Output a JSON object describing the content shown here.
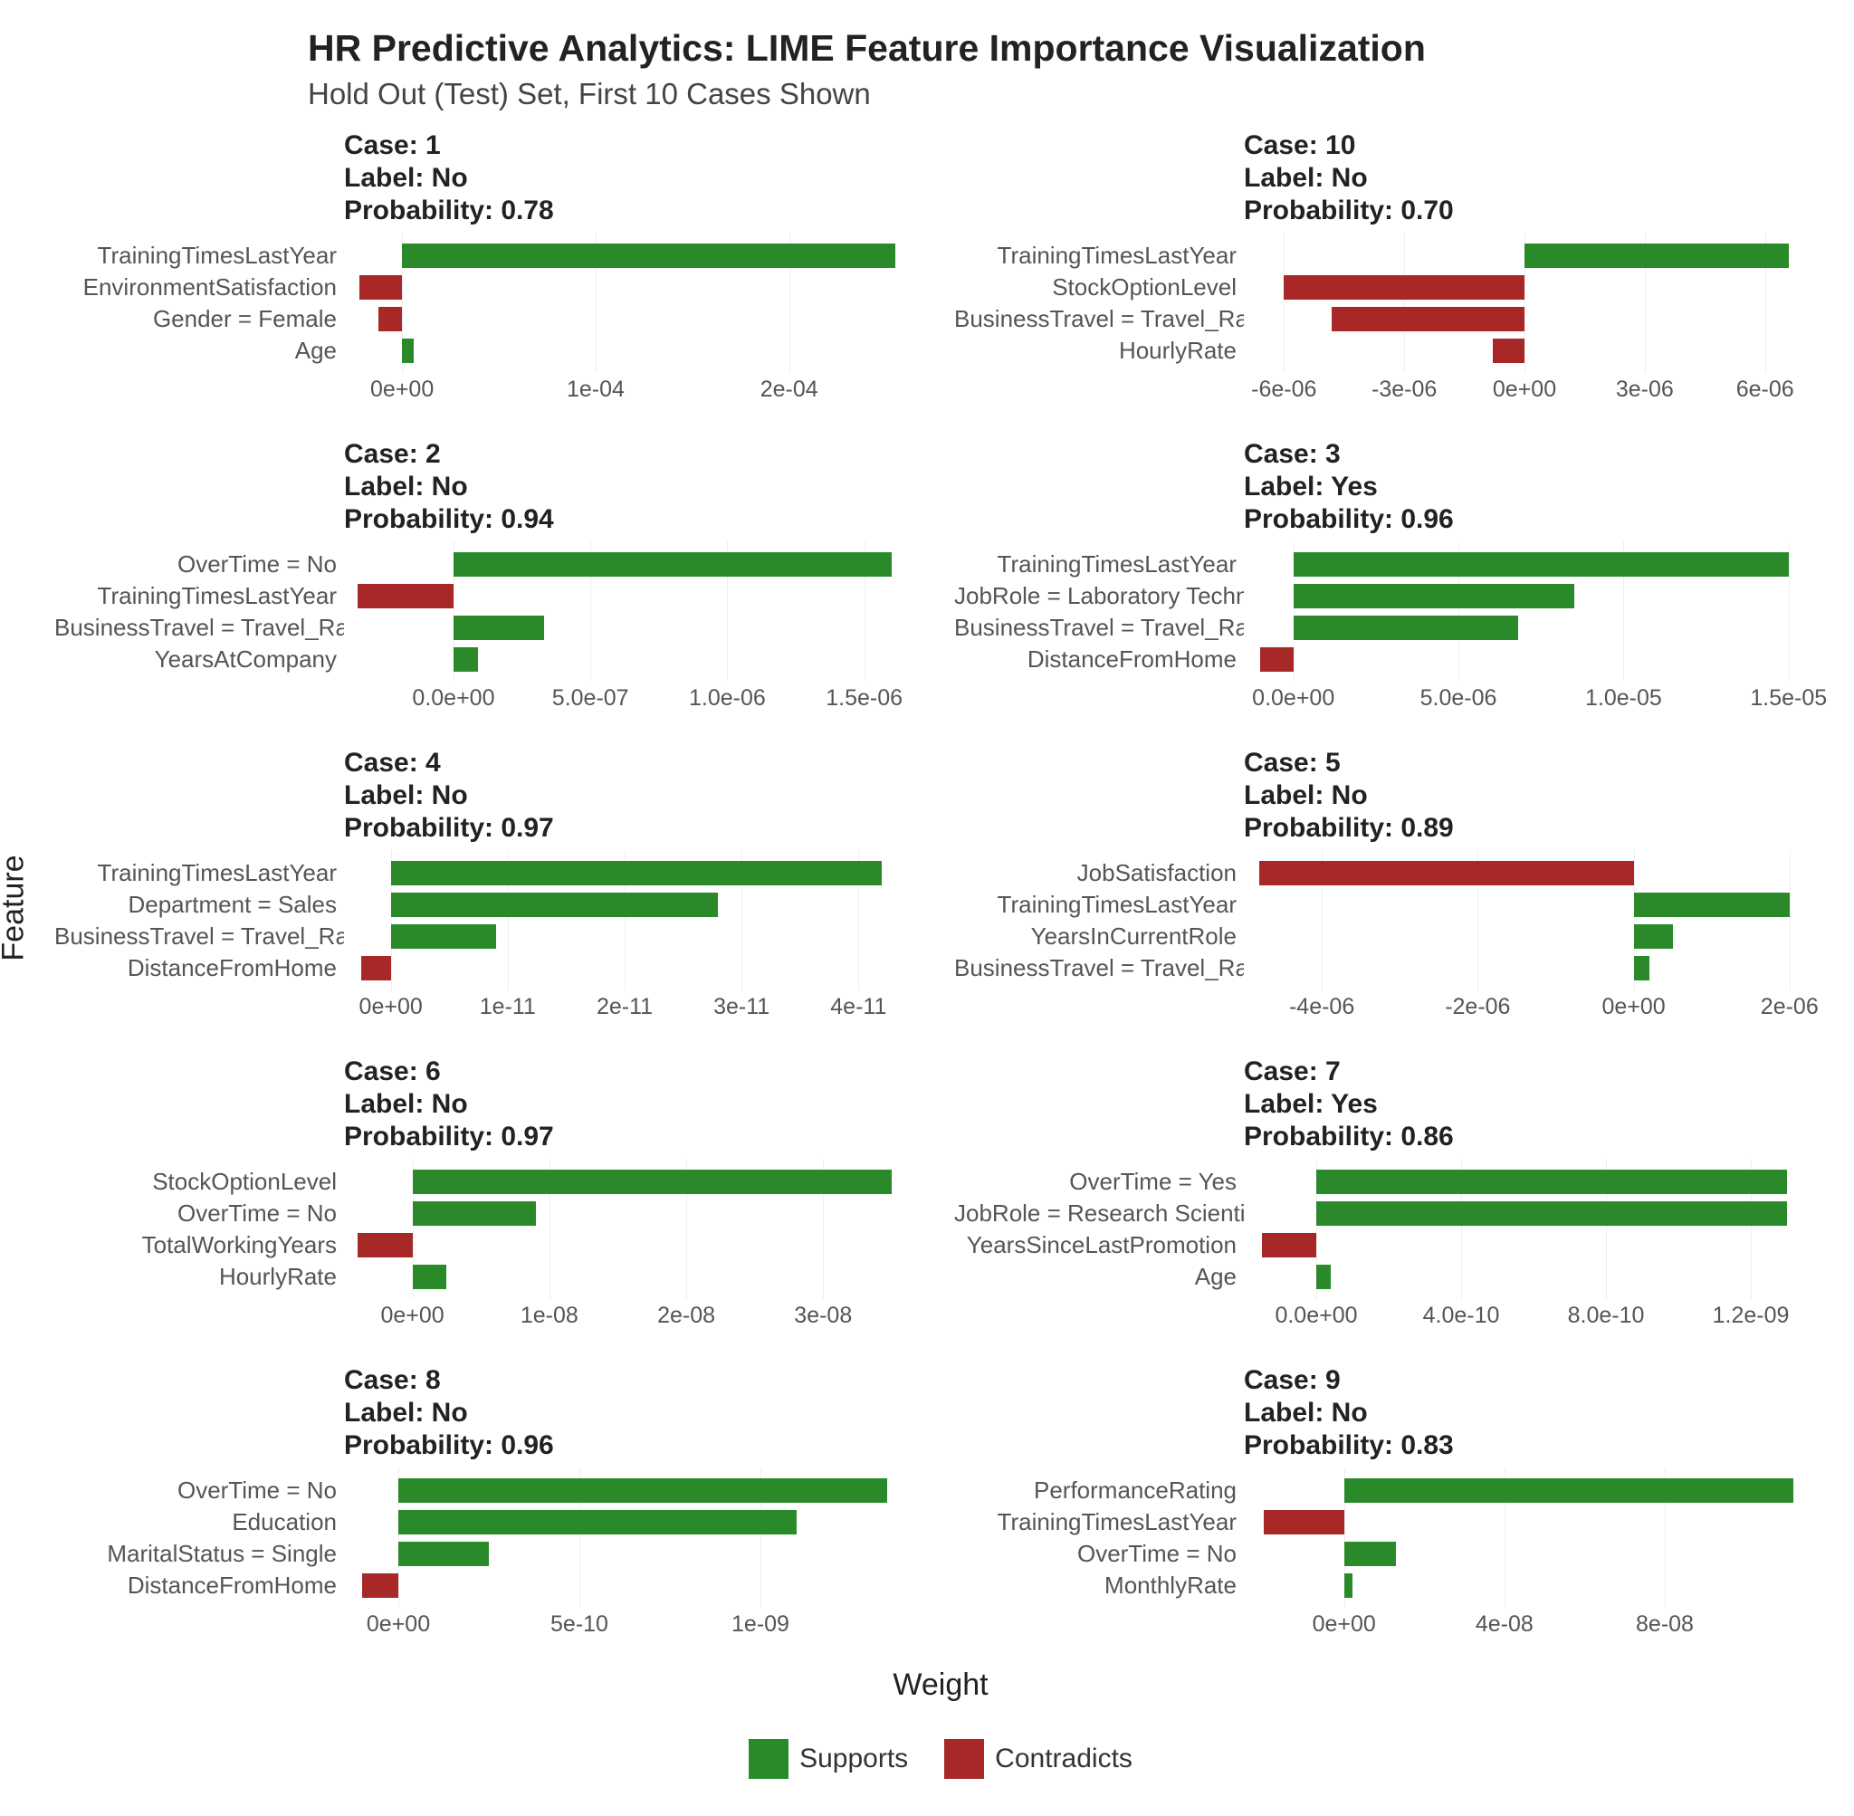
{
  "title": "HR Predictive Analytics: LIME Feature Importance Visualization",
  "subtitle": "Hold Out (Test) Set, First 10 Cases Shown",
  "ylabel": "Feature",
  "xlabel": "Weight",
  "legend": {
    "supports": "Supports",
    "contradicts": "Contradicts"
  },
  "colors": {
    "supports": "#2a8a2a",
    "contradicts": "#a82828"
  },
  "chart_data": [
    {
      "case": "Case: 1",
      "label": "Label: No",
      "prob": "Probability: 0.78",
      "xlim": [
        -3e-05,
        0.00026
      ],
      "ticks": [
        {
          "v": 0,
          "label": "0e+00"
        },
        {
          "v": 0.0001,
          "label": "1e-04"
        },
        {
          "v": 0.0002,
          "label": "2e-04"
        }
      ],
      "bars": [
        {
          "feature": "TrainingTimesLastYear",
          "value": 0.000255,
          "class": "supports"
        },
        {
          "feature": "EnvironmentSatisfaction",
          "value": -2.2e-05,
          "class": "contradicts"
        },
        {
          "feature": "Gender = Female",
          "value": -1.2e-05,
          "class": "contradicts"
        },
        {
          "feature": "Age",
          "value": 6e-06,
          "class": "supports"
        }
      ]
    },
    {
      "case": "Case: 10",
      "label": "Label: No",
      "prob": "Probability: 0.70",
      "xlim": [
        -7e-06,
        7e-06
      ],
      "ticks": [
        {
          "v": -6e-06,
          "label": "-6e-06"
        },
        {
          "v": -3e-06,
          "label": "-3e-06"
        },
        {
          "v": 0,
          "label": "0e+00"
        },
        {
          "v": 3e-06,
          "label": "3e-06"
        },
        {
          "v": 6e-06,
          "label": "6e-06"
        }
      ],
      "bars": [
        {
          "feature": "TrainingTimesLastYear",
          "value": 6.6e-06,
          "class": "supports"
        },
        {
          "feature": "StockOptionLevel",
          "value": -6e-06,
          "class": "contradicts"
        },
        {
          "feature": "BusinessTravel = Travel_Rarely",
          "value": -4.8e-06,
          "class": "contradicts"
        },
        {
          "feature": "HourlyRate",
          "value": -8e-07,
          "class": "contradicts"
        }
      ]
    },
    {
      "case": "Case: 2",
      "label": "Label: No",
      "prob": "Probability: 0.94",
      "xlim": [
        -4e-07,
        1.65e-06
      ],
      "ticks": [
        {
          "v": 0,
          "label": "0.0e+00"
        },
        {
          "v": 5e-07,
          "label": "5.0e-07"
        },
        {
          "v": 1e-06,
          "label": "1.0e-06"
        },
        {
          "v": 1.5e-06,
          "label": "1.5e-06"
        }
      ],
      "bars": [
        {
          "feature": "OverTime = No",
          "value": 1.6e-06,
          "class": "supports"
        },
        {
          "feature": "TrainingTimesLastYear",
          "value": -3.5e-07,
          "class": "contradicts"
        },
        {
          "feature": "BusinessTravel = Travel_Rarely",
          "value": 3.3e-07,
          "class": "supports"
        },
        {
          "feature": "YearsAtCompany",
          "value": 9e-08,
          "class": "supports"
        }
      ]
    },
    {
      "case": "Case: 3",
      "label": "Label: Yes",
      "prob": "Probability: 0.96",
      "xlim": [
        -1.5e-06,
        1.55e-05
      ],
      "ticks": [
        {
          "v": 0,
          "label": "0.0e+00"
        },
        {
          "v": 5e-06,
          "label": "5.0e-06"
        },
        {
          "v": 1e-05,
          "label": "1.0e-05"
        },
        {
          "v": 1.5e-05,
          "label": "1.5e-05"
        }
      ],
      "bars": [
        {
          "feature": "TrainingTimesLastYear",
          "value": 1.5e-05,
          "class": "supports"
        },
        {
          "feature": "JobRole = Laboratory Technician",
          "value": 8.5e-06,
          "class": "supports"
        },
        {
          "feature": "BusinessTravel = Travel_Rarely",
          "value": 6.8e-06,
          "class": "supports"
        },
        {
          "feature": "DistanceFromHome",
          "value": -1e-06,
          "class": "contradicts"
        }
      ]
    },
    {
      "case": "Case: 4",
      "label": "Label: No",
      "prob": "Probability: 0.97",
      "xlim": [
        -4e-12,
        4.4e-11
      ],
      "ticks": [
        {
          "v": 0,
          "label": "0e+00"
        },
        {
          "v": 1e-11,
          "label": "1e-11"
        },
        {
          "v": 2e-11,
          "label": "2e-11"
        },
        {
          "v": 3e-11,
          "label": "3e-11"
        },
        {
          "v": 4e-11,
          "label": "4e-11"
        }
      ],
      "bars": [
        {
          "feature": "TrainingTimesLastYear",
          "value": 4.2e-11,
          "class": "supports"
        },
        {
          "feature": "Department = Sales",
          "value": 2.8e-11,
          "class": "supports"
        },
        {
          "feature": "BusinessTravel = Travel_Rarely",
          "value": 9e-12,
          "class": "supports"
        },
        {
          "feature": "DistanceFromHome",
          "value": -2.5e-12,
          "class": "contradicts"
        }
      ]
    },
    {
      "case": "Case: 5",
      "label": "Label: No",
      "prob": "Probability: 0.89",
      "xlim": [
        -5e-06,
        2.2e-06
      ],
      "ticks": [
        {
          "v": -4e-06,
          "label": "-4e-06"
        },
        {
          "v": -2e-06,
          "label": "-2e-06"
        },
        {
          "v": 0,
          "label": "0e+00"
        },
        {
          "v": 2e-06,
          "label": "2e-06"
        }
      ],
      "bars": [
        {
          "feature": "JobSatisfaction",
          "value": -4.8e-06,
          "class": "contradicts"
        },
        {
          "feature": "TrainingTimesLastYear",
          "value": 2e-06,
          "class": "supports"
        },
        {
          "feature": "YearsInCurrentRole",
          "value": 5e-07,
          "class": "supports"
        },
        {
          "feature": "BusinessTravel = Travel_Rarely",
          "value": 2e-07,
          "class": "supports"
        }
      ]
    },
    {
      "case": "Case: 6",
      "label": "Label: No",
      "prob": "Probability: 0.97",
      "xlim": [
        -5e-09,
        3.6e-08
      ],
      "ticks": [
        {
          "v": 0,
          "label": "0e+00"
        },
        {
          "v": 1e-08,
          "label": "1e-08"
        },
        {
          "v": 2e-08,
          "label": "2e-08"
        },
        {
          "v": 3e-08,
          "label": "3e-08"
        }
      ],
      "bars": [
        {
          "feature": "StockOptionLevel",
          "value": 3.5e-08,
          "class": "supports"
        },
        {
          "feature": "OverTime = No",
          "value": 9e-09,
          "class": "supports"
        },
        {
          "feature": "TotalWorkingYears",
          "value": -4e-09,
          "class": "contradicts"
        },
        {
          "feature": "HourlyRate",
          "value": 2.5e-09,
          "class": "supports"
        }
      ]
    },
    {
      "case": "Case: 7",
      "label": "Label: Yes",
      "prob": "Probability: 0.86",
      "xlim": [
        -2e-10,
        1.35e-09
      ],
      "ticks": [
        {
          "v": 0,
          "label": "0.0e+00"
        },
        {
          "v": 4e-10,
          "label": "4.0e-10"
        },
        {
          "v": 8e-10,
          "label": "8.0e-10"
        },
        {
          "v": 1.2e-09,
          "label": "1.2e-09"
        }
      ],
      "bars": [
        {
          "feature": "OverTime = Yes",
          "value": 1.3e-09,
          "class": "supports"
        },
        {
          "feature": "JobRole = Research Scientist",
          "value": 1.3e-09,
          "class": "supports"
        },
        {
          "feature": "YearsSinceLastPromotion",
          "value": -1.5e-10,
          "class": "contradicts"
        },
        {
          "feature": "Age",
          "value": 4e-11,
          "class": "supports"
        }
      ]
    },
    {
      "case": "Case: 8",
      "label": "Label: No",
      "prob": "Probability: 0.96",
      "xlim": [
        -1.5e-10,
        1.4e-09
      ],
      "ticks": [
        {
          "v": 0,
          "label": "0e+00"
        },
        {
          "v": 5e-10,
          "label": "5e-10"
        },
        {
          "v": 1e-09,
          "label": "1e-09"
        }
      ],
      "bars": [
        {
          "feature": "OverTime = No",
          "value": 1.35e-09,
          "class": "supports"
        },
        {
          "feature": "Education",
          "value": 1.1e-09,
          "class": "supports"
        },
        {
          "feature": "MaritalStatus = Single",
          "value": 2.5e-10,
          "class": "supports"
        },
        {
          "feature": "DistanceFromHome",
          "value": -1e-10,
          "class": "contradicts"
        }
      ]
    },
    {
      "case": "Case: 9",
      "label": "Label: No",
      "prob": "Probability: 0.83",
      "xlim": [
        -2.5e-08,
        1.15e-07
      ],
      "ticks": [
        {
          "v": 0,
          "label": "0e+00"
        },
        {
          "v": 4e-08,
          "label": "4e-08"
        },
        {
          "v": 8e-08,
          "label": "8e-08"
        }
      ],
      "bars": [
        {
          "feature": "PerformanceRating",
          "value": 1.12e-07,
          "class": "supports"
        },
        {
          "feature": "TrainingTimesLastYear",
          "value": -2e-08,
          "class": "contradicts"
        },
        {
          "feature": "OverTime = No",
          "value": 1.3e-08,
          "class": "supports"
        },
        {
          "feature": "MonthlyRate",
          "value": 2e-09,
          "class": "supports"
        }
      ]
    }
  ]
}
